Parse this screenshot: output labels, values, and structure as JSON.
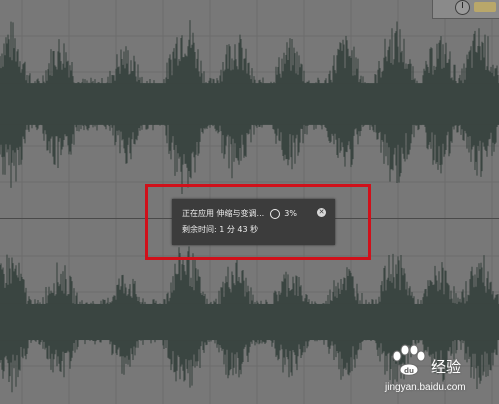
{
  "popup": {
    "status_text": "正在应用 伸缩与变调...",
    "percent": "3%",
    "remaining_label": "剩余时间: 1 分 43 秒",
    "cancel_symbol": "✕"
  },
  "watermark": {
    "brand_text": "经验",
    "site_text": "jingyan.baidu.com"
  },
  "colors": {
    "background": "#787878",
    "waveform": "#3a4541",
    "popup_bg": "#3c3c3c",
    "highlight": "#d0101a"
  },
  "icons": {
    "spinner": "spinner-icon",
    "cancel": "close-circle-icon",
    "knob": "knob-icon",
    "watermark": "paw-logo-icon"
  }
}
